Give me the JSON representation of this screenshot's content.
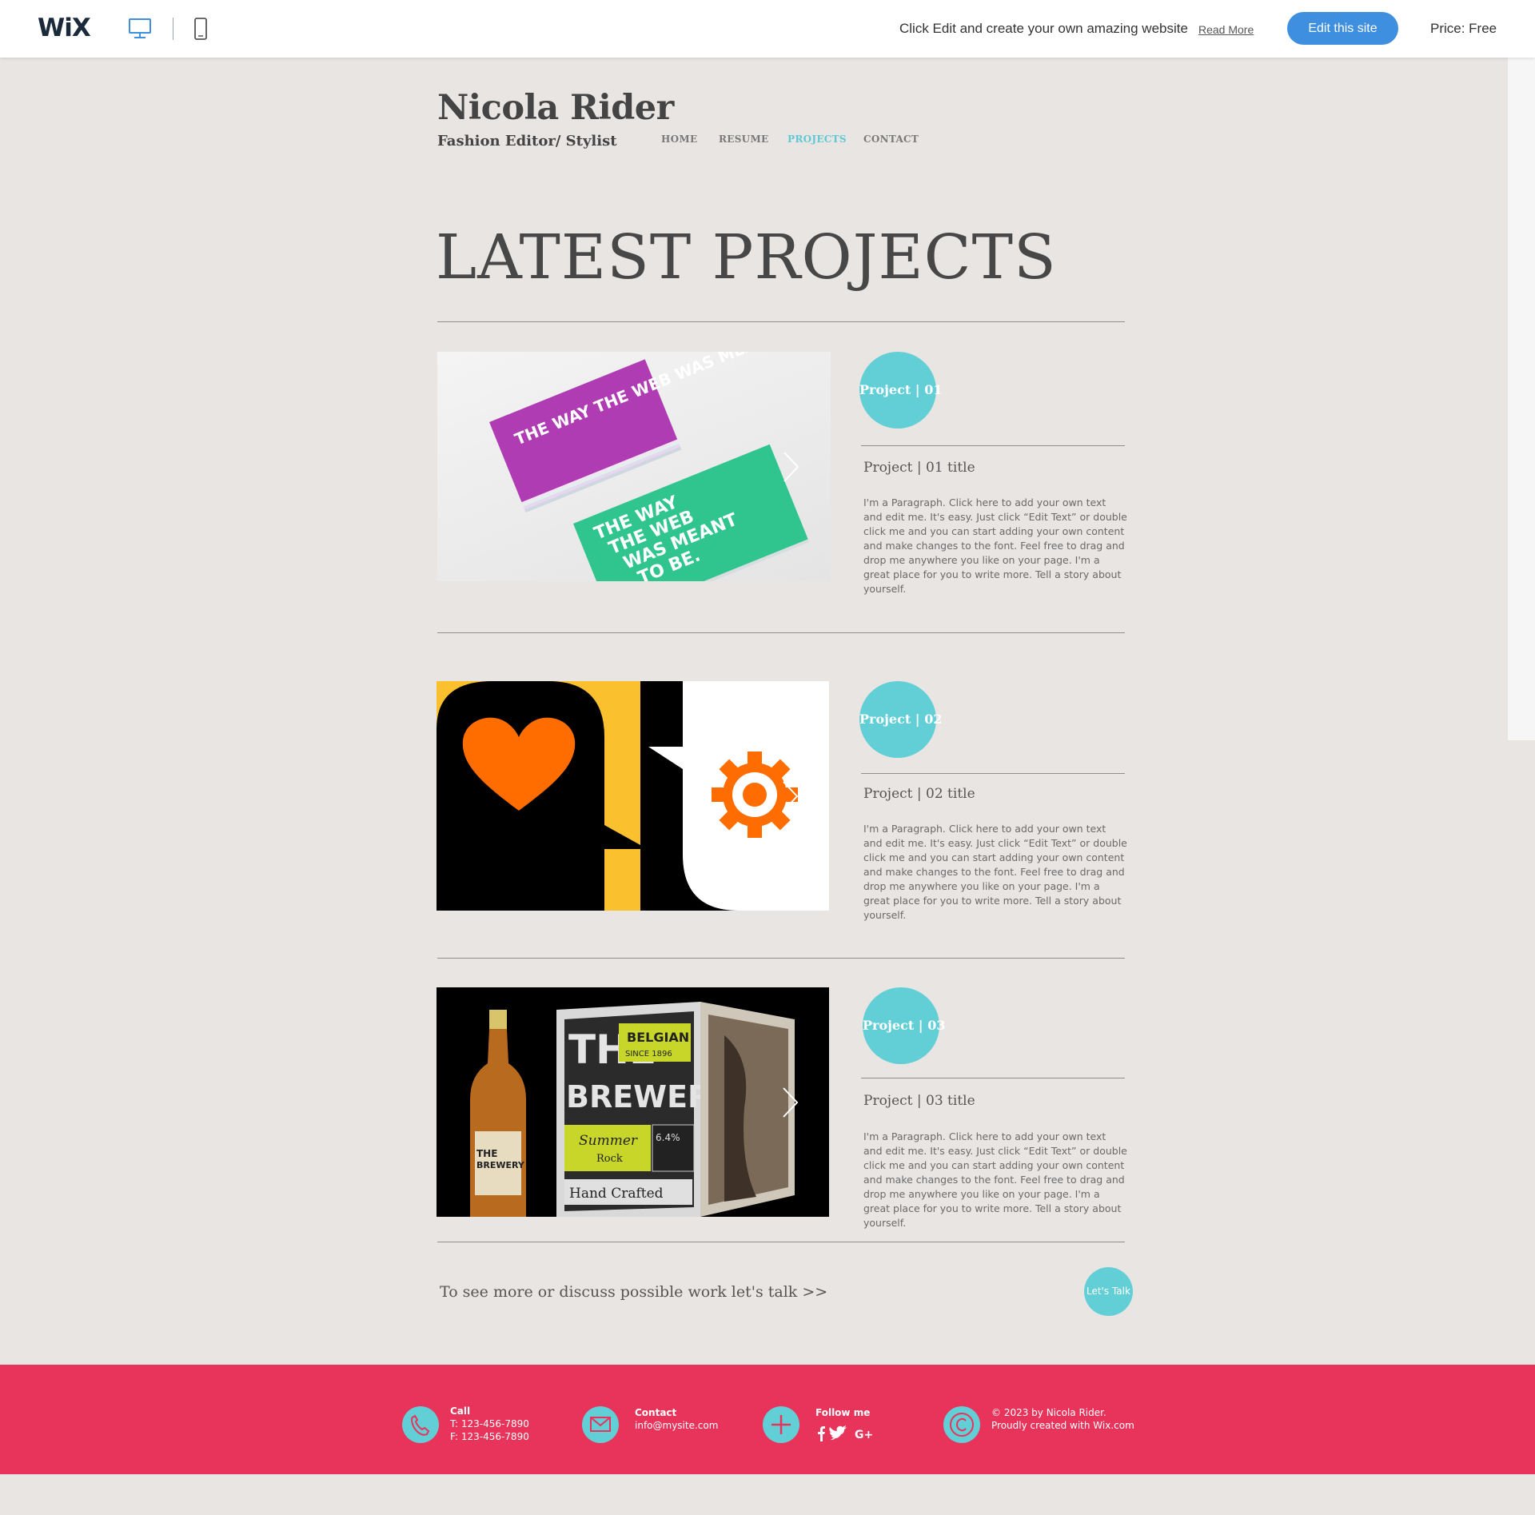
{
  "wixbar": {
    "logo": "WiX",
    "promo_text": "Click Edit and create your own amazing website",
    "read_more": "Read More",
    "edit_button": "Edit this site",
    "price": "Price: Free"
  },
  "header": {
    "name": "Nicola Rider",
    "subtitle": "Fashion Editor/ Stylist",
    "nav": [
      "HOME",
      "RESUME",
      "PROJECTS",
      "CONTACT"
    ],
    "active_nav": "PROJECTS"
  },
  "page": {
    "heading": "LATEST PROJECTS"
  },
  "projects": [
    {
      "badge": "Project | 01",
      "title": "Project | 01 title",
      "desc": "I'm a Paragraph. Click here to add your own text and edit me. It's easy. Just click “Edit Text” or double click me and you can start adding your own content and make changes to the font. Feel free to drag and drop me anywhere you like on your page. I'm a great place for you to write more. Tell a story about yourself.",
      "image_text": "THE WAY THE WEB WAS MEANT TO BE."
    },
    {
      "badge": "Project | 02",
      "title": "Project | 02 title",
      "desc": "I'm a Paragraph. Click here to add your own text and edit me. It's easy. Just click “Edit Text” or double click me and you can start adding your own content and make changes to the font. Feel free to drag and drop me anywhere you like on your page. I'm a great place for you to write more. Tell a story about yourself."
    },
    {
      "badge": "Project | 03",
      "title": "Project | 03 title",
      "desc": "I'm a Paragraph. Click here to add your own text and edit me. It's easy. Just click “Edit Text” or double click me and you can start adding your own content and make changes to the font. Feel free to drag and drop me anywhere you like on your page. I'm a great place for you to write more. Tell a story about yourself.",
      "image_text": {
        "the": "THE",
        "brewery": "BREWERY",
        "belgian": "BELGIAN",
        "since": "SINCE 1896",
        "summer": "Summer",
        "rock": "Rock",
        "abv": "6.4%",
        "hand_crafted": "Hand Crafted"
      }
    }
  ],
  "cta": {
    "text": "To see more or discuss possible work let's talk >>",
    "button": "Let's Talk"
  },
  "footer": {
    "call_label": "Call",
    "call_t": "T: 123-456-7890",
    "call_f": "F: 123-456-7890",
    "contact_label": "Contact",
    "contact_email": "info@mysite.com",
    "follow_label": "Follow me",
    "copyright_1": "© 2023 by Nicola Rider.",
    "copyright_2": "Proudly created with Wix.com"
  },
  "colors": {
    "accent": "#62cfd6",
    "footer_bg": "#e8345a",
    "page_bg": "#e8e5e3",
    "edit_button": "#3e8fe0"
  }
}
